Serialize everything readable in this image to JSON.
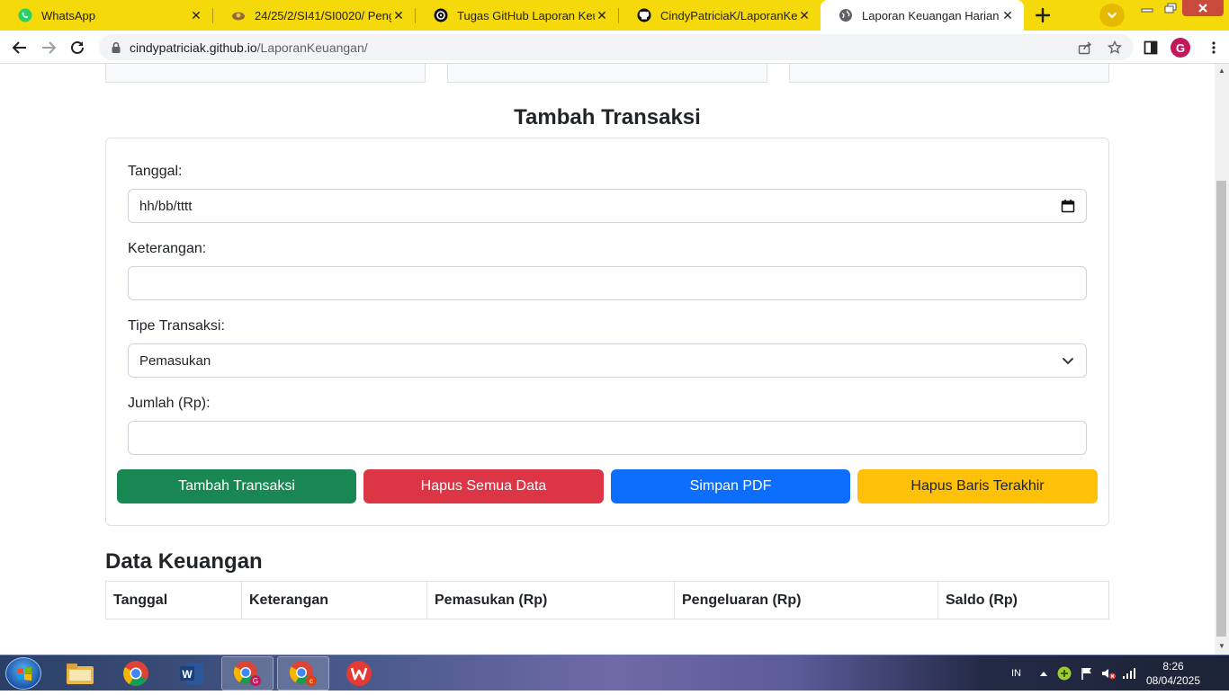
{
  "browser": {
    "tabs": [
      {
        "label": "WhatsApp",
        "icon": "whatsapp-icon"
      },
      {
        "label": "24/25/2/SI41/SI0020/ Pengem",
        "icon": "course-icon"
      },
      {
        "label": "Tugas GitHub Laporan Keuang",
        "icon": "chatgpt-icon"
      },
      {
        "label": "CindyPatriciaK/LaporanKeuang",
        "icon": "github-icon"
      },
      {
        "label": "Laporan Keuangan Harian",
        "icon": "globe-icon",
        "active": true
      }
    ],
    "url_host": "cindypatriciak.github.io",
    "url_path": "/LaporanKeuangan/",
    "profile_initial": "G",
    "accent_color": "#f5d90a"
  },
  "page": {
    "form_title": "Tambah Transaksi",
    "fields": {
      "date_label": "Tanggal:",
      "date_placeholder": "hh/bb/tttt",
      "desc_label": "Keterangan:",
      "desc_value": "",
      "type_label": "Tipe Transaksi:",
      "type_value": "Pemasukan",
      "amount_label": "Jumlah (Rp):",
      "amount_value": ""
    },
    "buttons": {
      "add": {
        "label": "Tambah Transaksi",
        "color": "#198754"
      },
      "clear_all": {
        "label": "Hapus Semua Data",
        "color": "#dc3545"
      },
      "save_pdf": {
        "label": "Simpan PDF",
        "color": "#0d6efd"
      },
      "delete_last": {
        "label": "Hapus Baris Terakhir",
        "color": "#ffc107"
      }
    },
    "data_title": "Data Keuangan",
    "table_headers": [
      "Tanggal",
      "Keterangan",
      "Pemasukan (Rp)",
      "Pengeluaran (Rp)",
      "Saldo (Rp)"
    ]
  },
  "taskbar": {
    "language": "IN",
    "time": "8:26",
    "date": "08/04/2025"
  }
}
